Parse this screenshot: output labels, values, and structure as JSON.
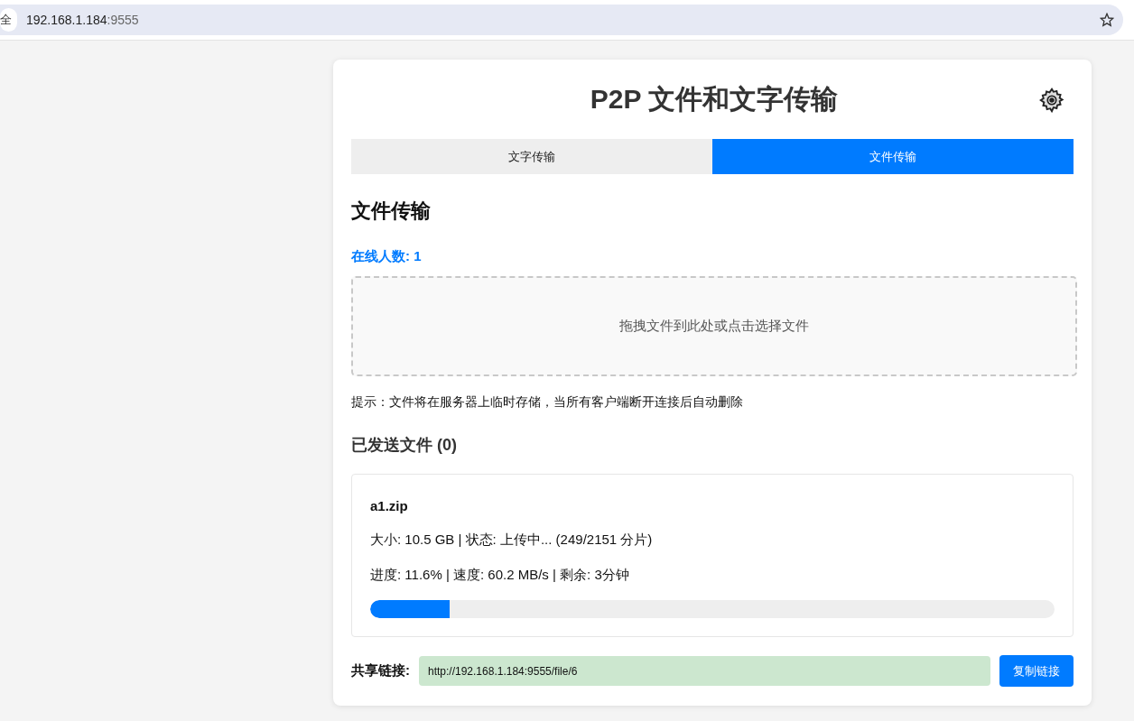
{
  "browser": {
    "security_chip": "全",
    "url_host": "192.168.1.184",
    "url_port": ":9555"
  },
  "title": "P2P 文件和文字传输",
  "tabs": [
    {
      "label": "文字传输",
      "selected": false
    },
    {
      "label": "文件传输",
      "selected": true
    }
  ],
  "section_title": "文件传输",
  "online_count": "在线人数: 1",
  "drop_zone": "拖拽文件到此处或点击选择文件",
  "hint": "提示：文件将在服务器上临时存储，当所有客户端断开连接后自动删除",
  "sent_title": "已发送文件 (0)",
  "files": [
    {
      "name": "a1.zip",
      "info": "大小: 10.5 GB | 状态: 上传中... (249/2151 分片)",
      "progress_text": "进度: 11.6% | 速度: 60.2 MB/s | 剩余: 3分钟",
      "level": 0.116
    }
  ],
  "share": {
    "label": "共享链接:",
    "value": "http://192.168.1.184:9555/file/6",
    "button": "复制链接"
  }
}
